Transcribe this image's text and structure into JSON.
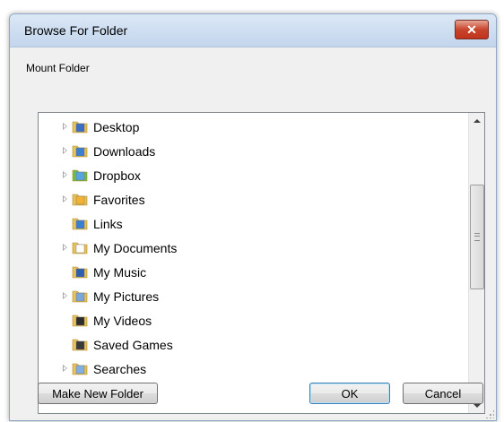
{
  "window": {
    "title": "Browse For Folder",
    "close_symbol": "✕"
  },
  "description": "Mount Folder",
  "tree": {
    "items": [
      {
        "label": "Desktop",
        "expandable": true,
        "icon": "desktop-folder-icon"
      },
      {
        "label": "Downloads",
        "expandable": true,
        "icon": "downloads-folder-icon"
      },
      {
        "label": "Dropbox",
        "expandable": true,
        "icon": "dropbox-icon"
      },
      {
        "label": "Favorites",
        "expandable": true,
        "icon": "favorites-folder-icon"
      },
      {
        "label": "Links",
        "expandable": false,
        "icon": "links-folder-icon"
      },
      {
        "label": "My Documents",
        "expandable": true,
        "icon": "documents-folder-icon"
      },
      {
        "label": "My Music",
        "expandable": false,
        "icon": "music-folder-icon"
      },
      {
        "label": "My Pictures",
        "expandable": true,
        "icon": "pictures-folder-icon"
      },
      {
        "label": "My Videos",
        "expandable": false,
        "icon": "videos-folder-icon"
      },
      {
        "label": "Saved Games",
        "expandable": false,
        "icon": "saved-games-folder-icon"
      },
      {
        "label": "Searches",
        "expandable": true,
        "icon": "searches-folder-icon"
      }
    ]
  },
  "buttons": {
    "make_new_folder": "Make New Folder",
    "ok": "OK",
    "cancel": "Cancel"
  },
  "colors": {
    "folder_yellow": "#e8c25a",
    "folder_blue": "#3a7fd0",
    "close_red": "#c8452c"
  }
}
